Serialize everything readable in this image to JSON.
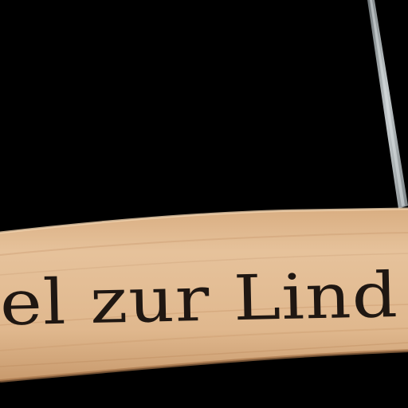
{
  "photo": {
    "background_color": "#000000",
    "wood_color": "#e1b98f",
    "wood_shadow_color": "#b8895e",
    "wire_color": "#9aa3a6",
    "engraving_color": "#1f1712"
  },
  "hanger": {
    "engraved_text": "el zur Lind"
  }
}
